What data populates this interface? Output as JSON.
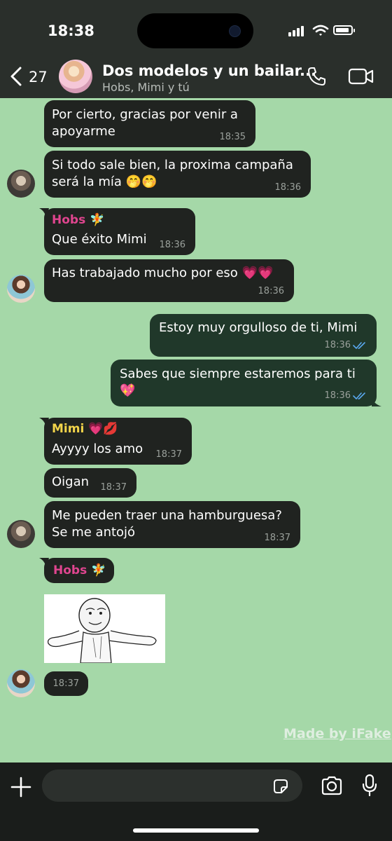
{
  "status_bar": {
    "time": "18:38"
  },
  "header": {
    "back_count": "27",
    "title": "Dos modelos y un bailar...",
    "subtitle": "Hobs, Mimi y tú"
  },
  "messages": [
    {
      "text_1": "Por cierto, gracias por venir a",
      "text_2": "apoyarme",
      "time": "18:35"
    },
    {
      "text_1": "Si todo sale bien, la proxima campaña",
      "text_2": "será la mía 🤭🤭",
      "time": "18:36"
    },
    {
      "sender": "Hobs 🧚",
      "text": "Que éxito Mimi",
      "time": "18:36"
    },
    {
      "text": "Has trabajado mucho por eso 💗💗",
      "time": "18:36"
    },
    {
      "text": "Estoy muy orgulloso de ti, Mimi",
      "time": "18:36"
    },
    {
      "text_1": "Sabes que siempre estaremos para ti",
      "text_2": "💖",
      "time": "18:36"
    },
    {
      "sender": "Mimi 💗💋",
      "text": "Ayyyy los amo",
      "time": "18:37"
    },
    {
      "text": "Oigan",
      "time": "18:37"
    },
    {
      "text_1": "Me pueden traer una hamburguesa?",
      "text_2": "Se me antojó",
      "time": "18:37"
    },
    {
      "sender": "Hobs 🧚"
    },
    {
      "time": "18:37"
    }
  ],
  "colors": {
    "chat_background": "#a5d8a8",
    "incoming_bubble": "#202320",
    "outgoing_bubble": "#20382a",
    "sender_hobs": "#e0458f",
    "sender_mimi": "#f2d44a",
    "read_ticks": "#5aa9f0"
  },
  "watermark": "Made by iFake",
  "composer": {
    "placeholder": ""
  }
}
